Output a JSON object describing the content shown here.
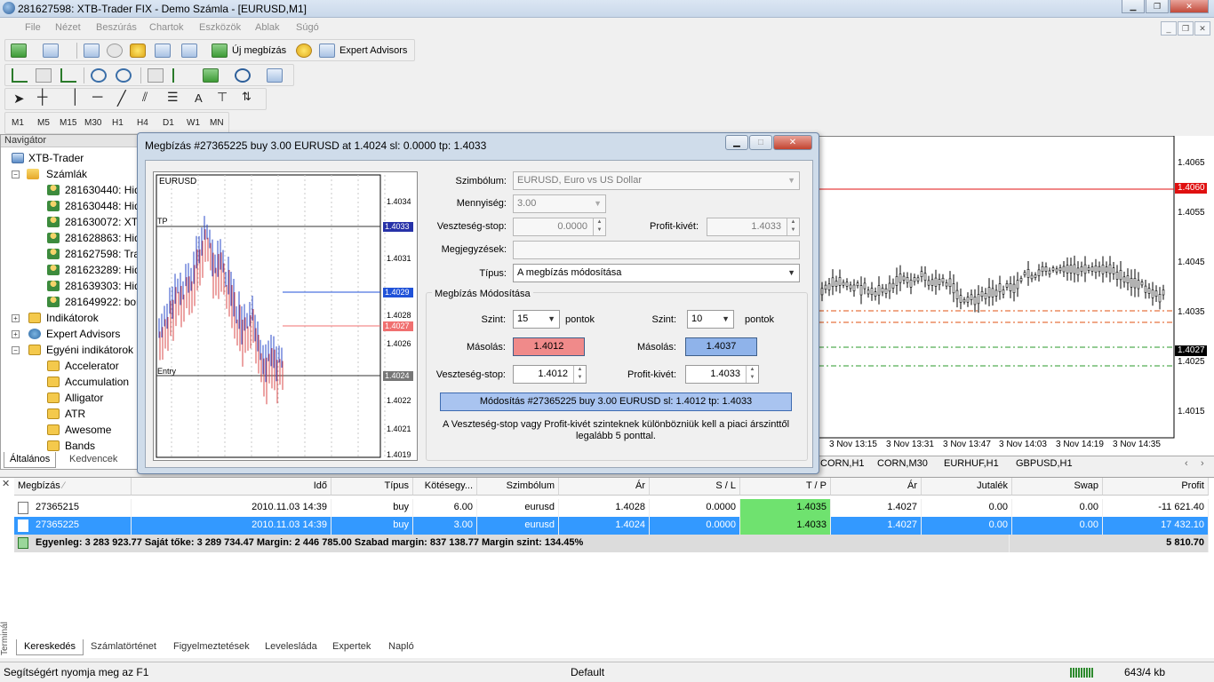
{
  "window": {
    "title": "281627598: XTB-Trader FIX - Demo Számla - [EURUSD,M1]"
  },
  "menu": [
    "File",
    "Nézet",
    "Beszúrás",
    "Chartok",
    "Eszközök",
    "Ablak",
    "Súgó"
  ],
  "toolbar": {
    "new_order": "Új megbízás",
    "expert_advisors": "Expert Advisors"
  },
  "timeframes": [
    "M1",
    "M5",
    "M15",
    "M30",
    "H1",
    "H4",
    "D1",
    "W1",
    "MN"
  ],
  "navigator": {
    "title": "Navigátor",
    "root": "XTB-Trader",
    "accounts_label": "Számlák",
    "accounts": [
      "281630440: Hidd",
      "281630448: Hidd",
      "281630072: XTB",
      "281628863: Hidd",
      "281627598: Trad",
      "281623289: Hidd",
      "281639303: Hidd",
      "281649922: bon"
    ],
    "indicators": "Indikátorok",
    "experts": "Expert Advisors",
    "custom": "Egyéni indikátorok",
    "custom_items": [
      "Accelerator",
      "Accumulation",
      "Alligator",
      "ATR",
      "Awesome",
      "Bands"
    ],
    "tabs": [
      "Általános",
      "Kedvencek"
    ]
  },
  "chart": {
    "price_labels": [
      "1.4065",
      "1.4055",
      "1.4045",
      "1.4035",
      "1.4025",
      "1.4015"
    ],
    "marker_red": "1.4060",
    "marker_black": "1.4027",
    "time_labels": [
      "3 Nov 13:15",
      "3 Nov 13:31",
      "3 Nov 13:47",
      "3 Nov 14:03",
      "3 Nov 14:19",
      "3 Nov 14:35"
    ],
    "tabs": [
      "CORN,H1",
      "CORN,M30",
      "EURHUF,H1",
      "GBPUSD,H1"
    ]
  },
  "dialog": {
    "title": "Megbízás #27365225 buy 3.00 EURUSD at 1.4024 sl: 0.0000 tp: 1.4033",
    "mini_chart": {
      "symbol": "EURUSD",
      "tp_label": "TP",
      "entry_label": "Entry",
      "prices": [
        "1.4034",
        "1.4031",
        "1.4028",
        "1.4026",
        "1.4022",
        "1.4021",
        "1.4019"
      ],
      "hl_tp": "1.4033",
      "hl_blue": "1.4029",
      "hl_red": "1.4027",
      "hl_entry": "1.4024"
    },
    "symbol_label": "Szimbólum:",
    "symbol_value": "EURUSD, Euro vs US Dollar",
    "qty_label": "Mennyiség:",
    "qty_value": "3.00",
    "sl_label": "Veszteség-stop:",
    "sl_value": "0.0000",
    "tp_label": "Profit-kivét:",
    "tp_value": "1.4033",
    "comment_label": "Megjegyzések:",
    "comment_value": "",
    "type_label": "Típus:",
    "type_value": "A megbízás módosítása",
    "group_title": "Megbízás Módosítása",
    "level_label": "Szint:",
    "level_sl": "15",
    "level_tp": "10",
    "points": "pontok",
    "copy_label": "Másolás:",
    "copy_sl": "1.4012",
    "copy_tp": "1.4037",
    "new_sl_label": "Veszteség-stop:",
    "new_sl": "1.4012",
    "new_tp_label": "Profit-kivét:",
    "new_tp": "1.4033",
    "modify_button": "Módosítás  #27365225 buy 3.00 EURUSD sl: 1.4012 tp: 1.4033",
    "note": "A Veszteség-stop  vagy Profit-kivét szinteknek különbözniük kell a piaci árszinttől legalább 5 ponttal.",
    "colors": {
      "sl_btn": "#f08a8a",
      "tp_btn": "#8fb3ea",
      "modify": "#a9c4f0"
    }
  },
  "terminal": {
    "side_label": "Terminál",
    "columns": [
      "Megbízás",
      "Idő",
      "Típus",
      "Kötésegy...",
      "Szimbólum",
      "Ár",
      "S / L",
      "T / P",
      "Ár",
      "Jutalék",
      "Swap",
      "Profit"
    ],
    "rows": [
      [
        "27365215",
        "2010.11.03 14:39",
        "buy",
        "6.00",
        "eurusd",
        "1.4028",
        "0.0000",
        "1.4035",
        "1.4027",
        "0.00",
        "0.00",
        "-11 621.40"
      ],
      [
        "27365225",
        "2010.11.03 14:39",
        "buy",
        "3.00",
        "eurusd",
        "1.4024",
        "0.0000",
        "1.4033",
        "1.4027",
        "0.00",
        "0.00",
        "17 432.10"
      ]
    ],
    "balance": "Egyenleg: 3 283 923.77  Saját tőke: 3 289 734.47  Margin: 2 446 785.00  Szabad margin: 837 138.77  Margin szint: 134.45%",
    "balance_profit": "5 810.70",
    "tabs": [
      "Kereskedés",
      "Számlatörténet",
      "Figyelmeztetések",
      "Levelesláda",
      "Expertek",
      "Napló"
    ]
  },
  "status": {
    "help": "Segítségért nyomja meg az F1",
    "profile": "Default",
    "traffic": "643/4 kb"
  }
}
